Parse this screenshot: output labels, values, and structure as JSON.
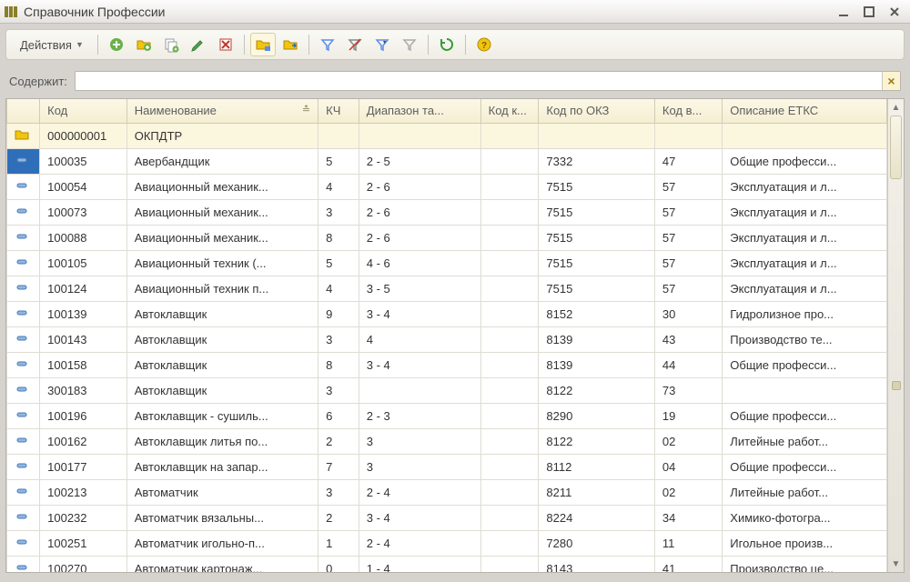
{
  "window": {
    "title": "Справочник Профессии"
  },
  "toolbar": {
    "actions_label": "Действия"
  },
  "filter": {
    "label": "Содержит:",
    "value": ""
  },
  "columns": {
    "code": "Код",
    "name": "Наименование",
    "kc": "КЧ",
    "diap": "Диапазон та...",
    "kodk": "Код к...",
    "okz": "Код по ОКЗ",
    "kodv": "Код в...",
    "etks": "Описание ЕТКС"
  },
  "folder_row": {
    "code": "000000001",
    "name": "ОКПДТР"
  },
  "rows": [
    {
      "code": "100035",
      "name": "Авербандщик",
      "kc": "5",
      "diap": "2 - 5",
      "kodk": "",
      "okz": "7332",
      "kodv": "47",
      "etks": "Общие професси..."
    },
    {
      "code": "100054",
      "name": "Авиационный механик...",
      "kc": "4",
      "diap": "2 - 6",
      "kodk": "",
      "okz": "7515",
      "kodv": "57",
      "etks": "Эксплуатация и л..."
    },
    {
      "code": "100073",
      "name": "Авиационный механик...",
      "kc": "3",
      "diap": "2 - 6",
      "kodk": "",
      "okz": "7515",
      "kodv": "57",
      "etks": "Эксплуатация и л..."
    },
    {
      "code": "100088",
      "name": "Авиационный механик...",
      "kc": "8",
      "diap": "2 - 6",
      "kodk": "",
      "okz": "7515",
      "kodv": "57",
      "etks": "Эксплуатация и л..."
    },
    {
      "code": "100105",
      "name": "Авиационный техник (...",
      "kc": "5",
      "diap": "4 - 6",
      "kodk": "",
      "okz": "7515",
      "kodv": "57",
      "etks": "Эксплуатация и л..."
    },
    {
      "code": "100124",
      "name": "Авиационный техник п...",
      "kc": "4",
      "diap": "3 - 5",
      "kodk": "",
      "okz": "7515",
      "kodv": "57",
      "etks": "Эксплуатация и л..."
    },
    {
      "code": "100139",
      "name": "Автоклавщик",
      "kc": "9",
      "diap": "3 - 4",
      "kodk": "",
      "okz": "8152",
      "kodv": "30",
      "etks": "Гидролизное про..."
    },
    {
      "code": "100143",
      "name": "Автоклавщик",
      "kc": "3",
      "diap": "4",
      "kodk": "",
      "okz": "8139",
      "kodv": "43",
      "etks": "Производство те..."
    },
    {
      "code": "100158",
      "name": "Автоклавщик",
      "kc": "8",
      "diap": "3 - 4",
      "kodk": "",
      "okz": "8139",
      "kodv": "44",
      "etks": "Общие професси..."
    },
    {
      "code": "300183",
      "name": "Автоклавщик",
      "kc": "3",
      "diap": "",
      "kodk": "",
      "okz": "8122",
      "kodv": "73",
      "etks": ""
    },
    {
      "code": "100196",
      "name": "Автоклавщик - сушиль...",
      "kc": "6",
      "diap": "2 - 3",
      "kodk": "",
      "okz": "8290",
      "kodv": "19",
      "etks": "Общие професси..."
    },
    {
      "code": "100162",
      "name": "Автоклавщик литья по...",
      "kc": "2",
      "diap": "3",
      "kodk": "",
      "okz": "8122",
      "kodv": "02",
      "etks": "Литейные работ..."
    },
    {
      "code": "100177",
      "name": "Автоклавщик на запар...",
      "kc": "7",
      "diap": "3",
      "kodk": "",
      "okz": "8112",
      "kodv": "04",
      "etks": "Общие професси..."
    },
    {
      "code": "100213",
      "name": "Автоматчик",
      "kc": "3",
      "diap": "2 - 4",
      "kodk": "",
      "okz": "8211",
      "kodv": "02",
      "etks": "Литейные работ..."
    },
    {
      "code": "100232",
      "name": "Автоматчик вязальны...",
      "kc": "2",
      "diap": "3 - 4",
      "kodk": "",
      "okz": "8224",
      "kodv": "34",
      "etks": "Химико-фотогра..."
    },
    {
      "code": "100251",
      "name": "Автоматчик игольно-п...",
      "kc": "1",
      "diap": "2 - 4",
      "kodk": "",
      "okz": "7280",
      "kodv": "11",
      "etks": "Игольное произв..."
    },
    {
      "code": "100270",
      "name": "Автоматчик картонаж...",
      "kc": "0",
      "diap": "1 - 4",
      "kodk": "",
      "okz": "8143",
      "kodv": "41",
      "etks": "Производство це..."
    }
  ]
}
